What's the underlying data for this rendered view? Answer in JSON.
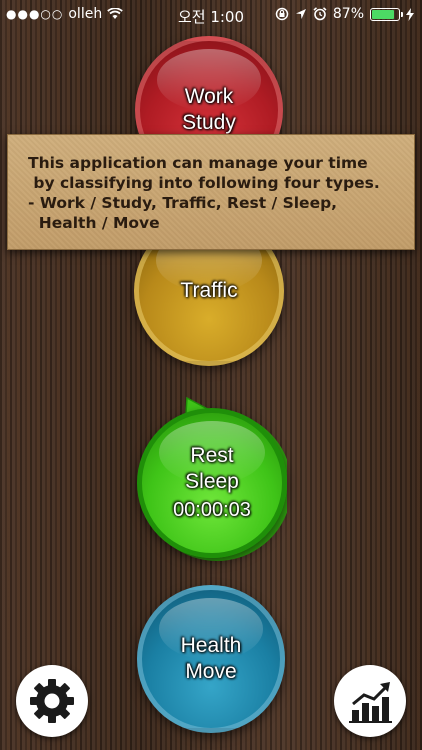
{
  "status_bar": {
    "signal": "●●●○○",
    "carrier": "olleh",
    "time": "오전 1:00",
    "battery_percent": "87%",
    "battery_level": 0.87
  },
  "categories": [
    {
      "id": "work",
      "lines": [
        "Work",
        "Study"
      ],
      "color": "#c2232b"
    },
    {
      "id": "traffic",
      "lines": [
        "Traffic"
      ],
      "color": "#c99a20"
    },
    {
      "id": "rest",
      "lines": [
        "Rest",
        "Sleep"
      ],
      "timer": "00:00:03",
      "color": "#4fd020"
    },
    {
      "id": "health",
      "lines": [
        "Health",
        "Move"
      ],
      "color": "#2290b5"
    }
  ],
  "tooltip": {
    "lines": [
      "This application can manage your time",
      " by classifying into following four types.",
      "- Work / Study, Traffic, Rest / Sleep,",
      "  Health / Move"
    ]
  },
  "icons": {
    "settings": "gear-icon",
    "stats": "bar-chart-icon"
  }
}
